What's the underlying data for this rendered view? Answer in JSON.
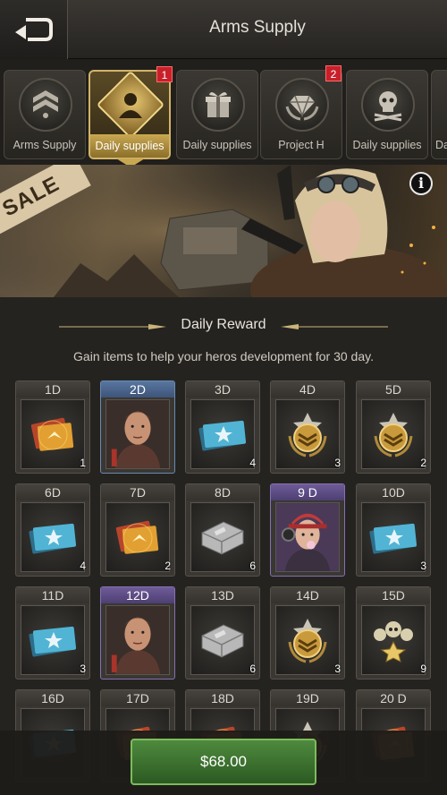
{
  "header": {
    "title": "Arms Supply"
  },
  "tabs": [
    {
      "label": "Arms Supply",
      "badge": ""
    },
    {
      "label": "Daily supplies",
      "badge": "1",
      "active": true
    },
    {
      "label": "Daily supplies",
      "badge": ""
    },
    {
      "label": "Project H",
      "badge": "2"
    },
    {
      "label": "Daily supplies",
      "badge": ""
    },
    {
      "label": "Da",
      "badge": ""
    }
  ],
  "banner": {
    "sale": "SALE",
    "info": "i"
  },
  "reward": {
    "title": "Daily Reward",
    "description": "Gain items to help your heros development for 30 day."
  },
  "days": [
    {
      "day": "1D",
      "item": "gold-cards-icon",
      "count": "1"
    },
    {
      "day": "2D",
      "item": "hero-portrait-male",
      "count": ""
    },
    {
      "day": "3D",
      "item": "blue-card-icon",
      "count": "4"
    },
    {
      "day": "4D",
      "item": "gold-rank-medal-icon",
      "count": "3"
    },
    {
      "day": "5D",
      "item": "gold-rank-medal-icon",
      "count": "2"
    },
    {
      "day": "6D",
      "item": "blue-card-icon",
      "count": "4"
    },
    {
      "day": "7D",
      "item": "gold-cards-icon",
      "count": "2"
    },
    {
      "day": "8D",
      "item": "silver-crate-icon",
      "count": "6"
    },
    {
      "day": "9 D",
      "item": "hero-portrait-female",
      "count": ""
    },
    {
      "day": "10D",
      "item": "blue-card-icon",
      "count": "3"
    },
    {
      "day": "11D",
      "item": "blue-card-icon",
      "count": "3"
    },
    {
      "day": "12D",
      "item": "hero-portrait-male",
      "count": ""
    },
    {
      "day": "13D",
      "item": "silver-crate-icon",
      "count": "6"
    },
    {
      "day": "14D",
      "item": "gold-rank-medal-icon",
      "count": "3"
    },
    {
      "day": "15D",
      "item": "skull-medal-icon",
      "count": "9"
    },
    {
      "day": "16D",
      "item": "blue-card-icon",
      "count": ""
    },
    {
      "day": "17D",
      "item": "gold-cards-icon",
      "count": ""
    },
    {
      "day": "18D",
      "item": "gold-cards-icon",
      "count": ""
    },
    {
      "day": "19D",
      "item": "gold-rank-medal-icon",
      "count": ""
    },
    {
      "day": "20 D",
      "item": "gold-cards-icon",
      "count": ""
    }
  ],
  "purchase": {
    "price": "$68.00"
  },
  "colors": {
    "gold": "#c9a852",
    "green": "#4e8a3e",
    "badge_red": "#c8202a"
  }
}
